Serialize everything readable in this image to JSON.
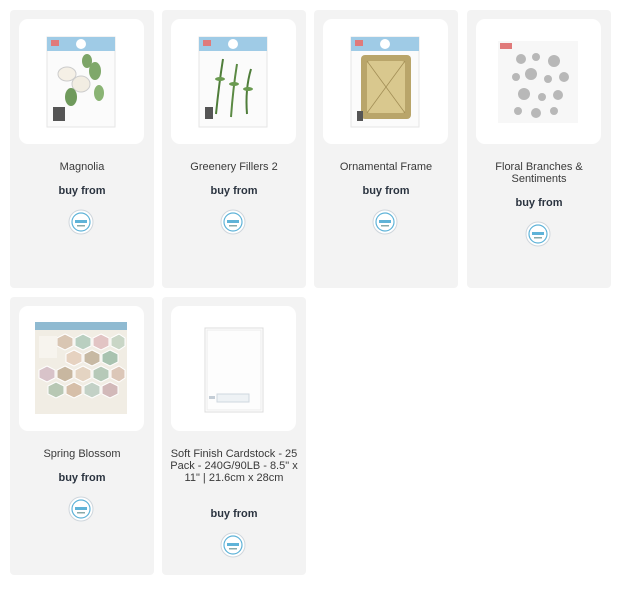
{
  "products": [
    {
      "name": "Magnolia",
      "buy_label": "buy from",
      "retailer_icon": "elizabeth-craft-designs-logo"
    },
    {
      "name": "Greenery Fillers 2",
      "buy_label": "buy from",
      "retailer_icon": "elizabeth-craft-designs-logo"
    },
    {
      "name": "Ornamental Frame",
      "buy_label": "buy from",
      "retailer_icon": "elizabeth-craft-designs-logo"
    },
    {
      "name": "Floral Branches & Sentiments",
      "buy_label": "buy from",
      "retailer_icon": "elizabeth-craft-designs-logo"
    },
    {
      "name": "Spring Blossom",
      "buy_label": "buy from",
      "retailer_icon": "elizabeth-craft-designs-logo"
    },
    {
      "name": "Soft Finish Cardstock - 25 Pack - 240G/90LB - 8.5\" x 11\" | 21.6cm x 28cm",
      "buy_label": "buy from",
      "retailer_icon": "elizabeth-craft-designs-logo"
    }
  ],
  "colors": {
    "card_bg": "#f3f3f3",
    "buy_text": "#2b3440",
    "logo_blue": "#5fb3d8"
  }
}
